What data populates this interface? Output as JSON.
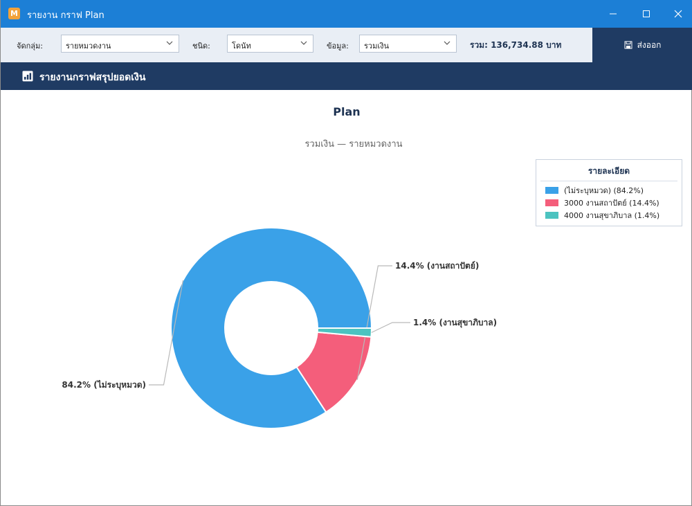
{
  "window": {
    "icon_letter": "M",
    "title": "รายงาน กราฟ  Plan",
    "titlebar_color": "#1c7fd6"
  },
  "toolbar": {
    "group_label": "จัดกลุ่ม:",
    "group_value": "รายหมวดงาน",
    "type_label": "ชนิด:",
    "type_value": "โดนัท",
    "data_label": "ข้อมูล:",
    "data_value": "รวมเงิน",
    "sum_text": "รวม: 136,734.88 บาท",
    "export_label": "ส่งออก",
    "export_icon": "save-icon"
  },
  "section": {
    "title": "รายงานกราฟสรุปยอดเงิน",
    "icon": "chart-box-icon",
    "color": "#1f3b63"
  },
  "chart_data": {
    "type": "pie",
    "style": "donut",
    "title": "Plan",
    "subtitle": "รวมเงิน — รายหมวดงาน",
    "legend_title": "รายละเอียด",
    "legend_position": "top-right",
    "slices": [
      {
        "label": "(ไม่ระบุหมวด)",
        "legend": "(ไม่ระบุหมวด)  (84.2%)",
        "data_label": "84.2% (ไม่ระบุหมวด)",
        "value": 84.2,
        "color": "#3aa1e8"
      },
      {
        "label": "3000 งานสถาปัตย์",
        "legend": "3000 งานสถาปัตย์  (14.4%)",
        "data_label": "14.4% (งานสถาปัตย์)",
        "value": 14.4,
        "color": "#f45e7b"
      },
      {
        "label": "4000 งานสุขาภิบาล",
        "legend": "4000 งานสุขาภิบาล  (1.4%)",
        "data_label": "1.4% (งานสุขาภิบาล)",
        "value": 1.4,
        "color": "#4cc3c0"
      }
    ]
  }
}
